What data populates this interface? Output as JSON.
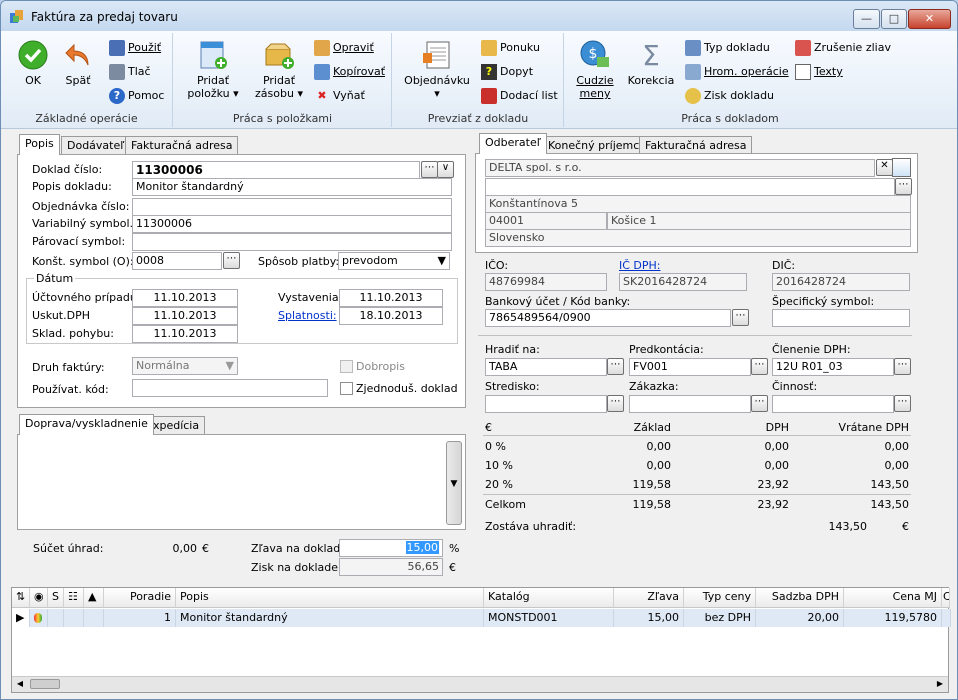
{
  "window": {
    "title": "Faktúra za predaj tovaru"
  },
  "ribbon": {
    "groups": {
      "basic": "Základné operácie",
      "items": "Práca s položkami",
      "import": "Prevziať z dokladu",
      "doc": "Práca s dokladom"
    },
    "ok": "OK",
    "back": "Späť",
    "use": "Použiť",
    "print": "Tlač",
    "help": "Pomoc",
    "add_item_1": "Pridať",
    "add_item_2": "položku",
    "add_stock_1": "Pridať",
    "add_stock_2": "zásobu",
    "edit": "Opraviť",
    "copy": "Kopírovať",
    "remove": "Vyňať",
    "order": "Objednávku",
    "offer": "Ponuku",
    "inquiry": "Dopyt",
    "delivery": "Dodací list",
    "foreign_1": "Cudzie",
    "foreign_2": "meny",
    "correction": "Korekcia",
    "doc_type": "Typ dokladu",
    "bulk_ops": "Hrom. operácie",
    "profit": "Zisk dokladu",
    "cancel_disc": "Zrušenie zliav",
    "texts": "Texty"
  },
  "left_tabs": [
    "Popis",
    "Dodávateľ",
    "Fakturačná adresa"
  ],
  "left": {
    "doc_no_label": "Doklad číslo:",
    "doc_no": "11300006",
    "desc_label": "Popis dokladu:",
    "desc": "Monitor štandardný",
    "order_no_label": "Objednávka číslo:",
    "order_no": "",
    "var_sym_label": "Variabilný symbol.:",
    "var_sym": "11300006",
    "pair_sym_label": "Párovací symbol:",
    "pair_sym": "",
    "const_sym_label": "Konšt. symbol (O):",
    "const_sym": "0008",
    "pay_label": "Spôsob platby:",
    "pay": "prevodom",
    "dates_label": "Dátum",
    "acc_case_label": "Účtovného prípadu:",
    "acc_case": "11.10.2013",
    "vat_date_label": "Uskut.DPH",
    "vat_date": "11.10.2013",
    "stock_move_label": "Sklad. pohybu:",
    "stock_move": "11.10.2013",
    "issue_label": "Vystavenia:",
    "issue": "11.10.2013",
    "due_label": "Splatnosti:",
    "due": "18.10.2013",
    "inv_kind_label": "Druh faktúry:",
    "inv_kind": "Normálna",
    "credit_note_label": "Dobropis",
    "user_code_label": "Používat. kód:",
    "user_code": "",
    "simplified_label": "Zjednoduš. doklad"
  },
  "bottom_tabs": [
    "Doprava/vyskladnenie",
    "Expedícia"
  ],
  "summary": {
    "payments_label": "Súčet úhrad:",
    "payments": "0,00",
    "payments_cur": "€",
    "discount_label": "Zľava na doklad:",
    "discount": "15,00",
    "discount_unit": "%",
    "profit_label": "Zisk na doklade:",
    "profit": "56,65",
    "profit_cur": "€"
  },
  "right_tabs": [
    "Odberateľ",
    "Konečný príjemca",
    "Fakturačná adresa"
  ],
  "customer": {
    "name": "DELTA spol. s r.o.",
    "line2": "",
    "street": "Konštantínova 5",
    "zip": "04001",
    "city": "Košice 1",
    "country": "Slovensko"
  },
  "ids": {
    "ico_label": "IČO:",
    "ico": "48769984",
    "icdph_label": "IČ DPH:",
    "icdph": "SK2016428724",
    "dic_label": "DIČ:",
    "dic": "2016428724",
    "bank_label": "Bankový účet / Kód banky:",
    "bank": "7865489564/0900",
    "spec_label": "Špecifický symbol:",
    "spec": ""
  },
  "acct": {
    "pay_via_label": "Hradiť na:",
    "pay_via": "TABA",
    "precont_label": "Predkontácia:",
    "precont": "FV001",
    "vat_split_label": "Členenie DPH:",
    "vat_split": "12U R01_03",
    "center_label": "Stredisko:",
    "center": "",
    "job_label": "Zákazka:",
    "job": "",
    "activity_label": "Činnosť:",
    "activity": ""
  },
  "vat": {
    "cur": "€",
    "h_base": "Základ",
    "h_vat": "DPH",
    "h_incl": "Vrátane DPH",
    "rows": [
      {
        "rate": "0 %",
        "base": "0,00",
        "vat": "0,00",
        "incl": "0,00"
      },
      {
        "rate": "10 %",
        "base": "0,00",
        "vat": "0,00",
        "incl": "0,00"
      },
      {
        "rate": "20 %",
        "base": "119,58",
        "vat": "23,92",
        "incl": "143,50"
      }
    ],
    "total_label": "Celkom",
    "total_base": "119,58",
    "total_vat": "23,92",
    "total_incl": "143,50",
    "remain_label": "Zostáva uhradiť:",
    "remain": "143,50",
    "remain_cur": "€"
  },
  "grid": {
    "cols": {
      "s": "S",
      "order": "Poradie",
      "desc": "Popis",
      "catalog": "Katalóg",
      "discount": "Zľava",
      "price_type": "Typ ceny",
      "vat_rate": "Sadzba DPH",
      "unit_price": "Cena MJ",
      "extra": "Ce"
    },
    "rows": [
      {
        "order": "1",
        "desc": "Monitor štandardný",
        "catalog": "MONSTD001",
        "discount": "15,00",
        "price_type": "bez DPH",
        "vat_rate": "20,00",
        "unit_price": "119,5780"
      }
    ]
  }
}
